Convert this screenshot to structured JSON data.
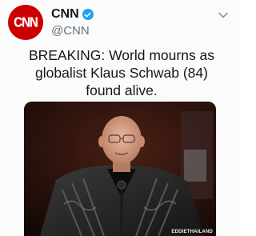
{
  "account": {
    "name": "CNN",
    "handle": "@CNN",
    "avatar_logo_text": "CNN",
    "brand_color": "#cc0000",
    "verified_color": "#1da1f2"
  },
  "tweet": {
    "lines": [
      "BREAKING:  World mourns as",
      "globalist Klaus Schwab (84)",
      "found alive."
    ]
  },
  "media": {
    "watermark": "EDDIETHAILAND"
  },
  "icons": {
    "verified": "verified-badge-icon",
    "menu": "chevron-down-icon"
  }
}
